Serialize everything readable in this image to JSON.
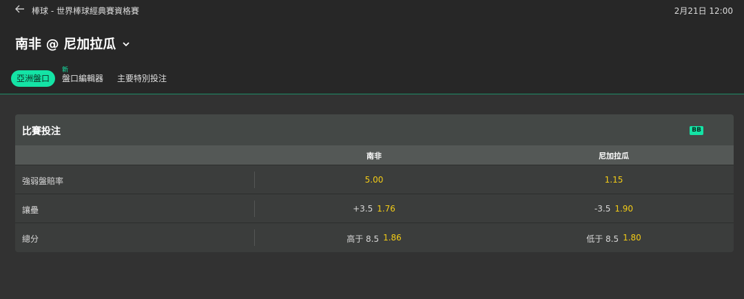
{
  "header": {
    "breadcrumb": "棒球 - 世界棒球經典賽資格賽",
    "datetime": "2月21日 12:00",
    "event_title": "南非 @ 尼加拉瓜"
  },
  "tabs": [
    {
      "label": "亞洲盤口",
      "active": true
    },
    {
      "label": "盤口編輯器",
      "badge": "新"
    },
    {
      "label": "主要特別投注"
    }
  ],
  "panel": {
    "title": "比賽投注",
    "badge": "BB",
    "columns": [
      "南非",
      "尼加拉瓜"
    ],
    "rows": [
      {
        "label": "強弱盤賠率",
        "home": {
          "handicap": "",
          "price": "5.00"
        },
        "away": {
          "handicap": "",
          "price": "1.15"
        }
      },
      {
        "label": "讓壘",
        "home": {
          "handicap": "+3.5",
          "price": "1.76"
        },
        "away": {
          "handicap": "-3.5",
          "price": "1.90"
        }
      },
      {
        "label": "總分",
        "home": {
          "handicap": "高于 8.5",
          "price": "1.86"
        },
        "away": {
          "handicap": "低于 8.5",
          "price": "1.80"
        }
      }
    ]
  },
  "colors": {
    "accent": "#14e3a5",
    "price": "#f5cd16",
    "background": "#323232",
    "header": "#272727"
  },
  "icons": {
    "back": "arrow-left-icon",
    "expand": "chevron-down-icon"
  }
}
